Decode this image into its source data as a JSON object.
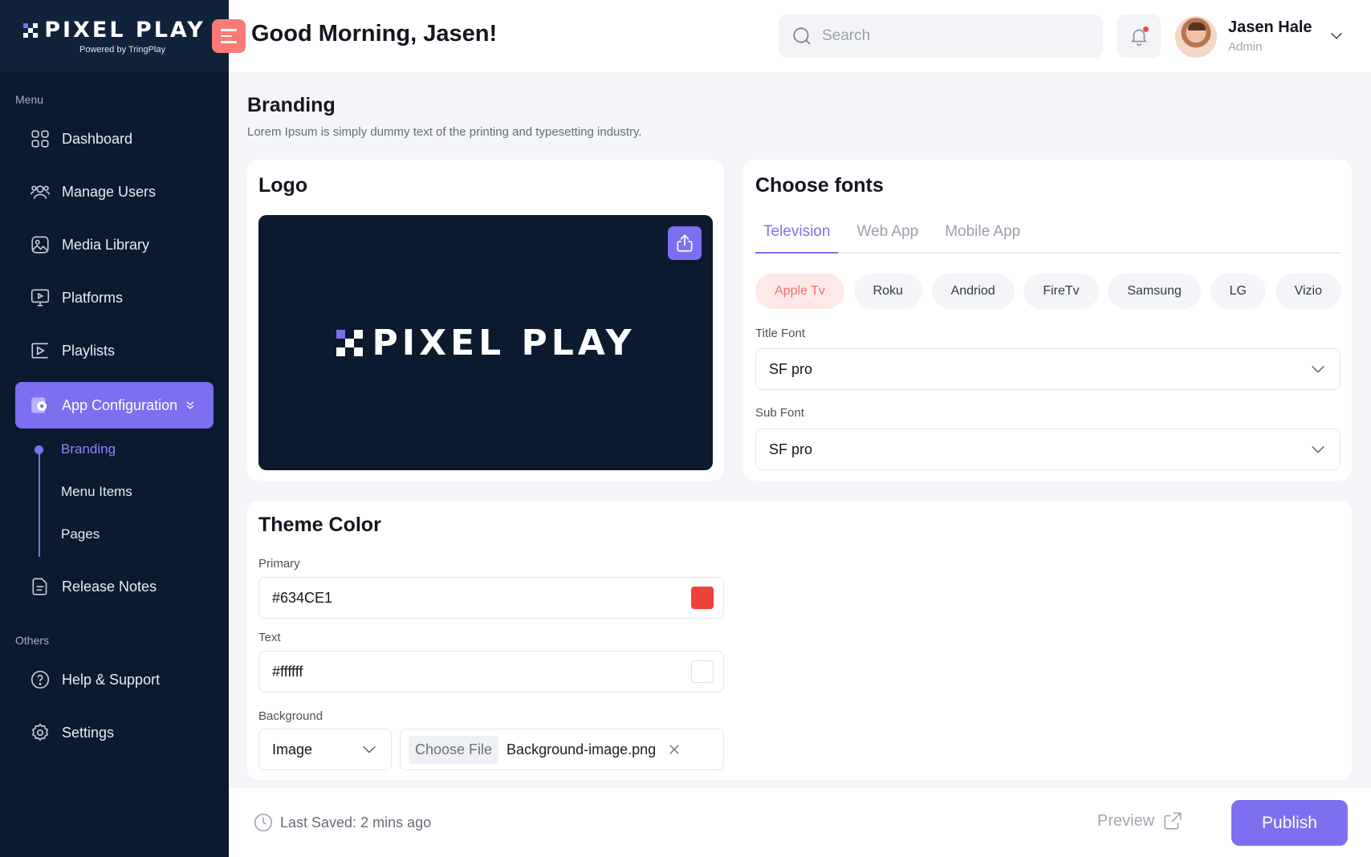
{
  "brand": {
    "name": "PIXEL PLAY",
    "powered_by": "Powered by TringPlay"
  },
  "header": {
    "greeting": "Good Morning, Jasen!",
    "search_placeholder": "Search",
    "user": {
      "name": "Jasen Hale",
      "role": "Admin"
    }
  },
  "sidebar": {
    "menu_heading": "Menu",
    "others_heading": "Others",
    "items": [
      {
        "label": "Dashboard",
        "icon": "grid-icon"
      },
      {
        "label": "Manage Users",
        "icon": "users-icon"
      },
      {
        "label": "Media Library",
        "icon": "image-icon"
      },
      {
        "label": "Platforms",
        "icon": "monitor-play-icon"
      },
      {
        "label": "Playlists",
        "icon": "playlist-icon"
      },
      {
        "label": "App Configuration",
        "icon": "app-settings-icon",
        "active": true
      },
      {
        "label": "Release Notes",
        "icon": "document-icon"
      }
    ],
    "sub_items": [
      {
        "label": "Branding",
        "active": true
      },
      {
        "label": "Menu Items"
      },
      {
        "label": "Pages"
      }
    ],
    "other_items": [
      {
        "label": "Help & Support",
        "icon": "help-icon"
      },
      {
        "label": "Settings",
        "icon": "gear-icon"
      }
    ]
  },
  "page": {
    "title": "Branding",
    "description": "Lorem Ipsum is simply dummy text of the printing and typesetting industry."
  },
  "logo_card": {
    "title": "Logo",
    "logo_text": "PIXEL PLAY"
  },
  "fonts_card": {
    "title": "Choose fonts",
    "tabs": [
      "Television",
      "Web App",
      "Mobile App"
    ],
    "active_tab": "Television",
    "platforms": [
      "Apple Tv",
      "Roku",
      "Andriod",
      "FireTv",
      "Samsung",
      "LG",
      "Vizio"
    ],
    "active_platform": "Apple Tv",
    "title_font_label": "Title Font",
    "title_font_value": "SF pro",
    "sub_font_label": "Sub Font",
    "sub_font_value": "SF pro"
  },
  "theme_card": {
    "title": "Theme Color",
    "primary_label": "Primary",
    "primary_value": "#634CE1",
    "primary_swatch": "#f0403c",
    "text_label": "Text",
    "text_value": "#ffffff",
    "text_swatch": "#ffffff",
    "background_label": "Background",
    "background_type": "Image",
    "choose_file_label": "Choose File",
    "file_name": "Background-image.png"
  },
  "footer": {
    "last_saved": "Last Saved: 2 mins ago",
    "preview_label": "Preview",
    "publish_label": "Publish"
  },
  "colors": {
    "sidebar_bg": "#0b1a2e",
    "accent": "#7c6ff0",
    "coral": "#fb7a75"
  }
}
